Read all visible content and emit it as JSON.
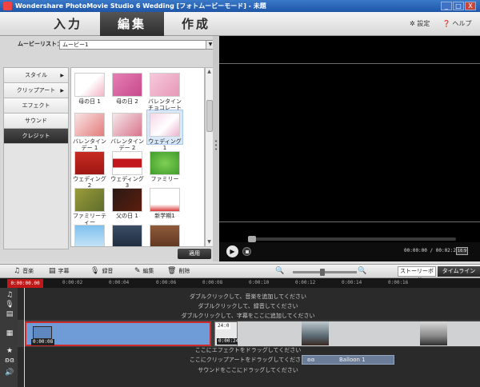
{
  "titlebar": {
    "title": "Wondershare PhotoMovie Studio 6 Wedding [フォトムービーモード] - 未題",
    "min": "_",
    "max": "□",
    "close": "X"
  },
  "top_tabs": [
    {
      "label": "入力"
    },
    {
      "label": "編集"
    },
    {
      "label": "作成"
    }
  ],
  "header": {
    "settings": "設定",
    "help": "ヘルプ"
  },
  "movie_list": {
    "label": "ムービーリスト：",
    "value": "ムービー1"
  },
  "categories": [
    {
      "label": "スタイル"
    },
    {
      "label": "クリップアート"
    },
    {
      "label": "エフェクト"
    },
    {
      "label": "サウンド"
    },
    {
      "label": "クレジット"
    }
  ],
  "thumbnails": [
    {
      "label": "母の日 1"
    },
    {
      "label": "母の日 2"
    },
    {
      "label": "バレンタインチョコレート"
    },
    {
      "label": "バレンタインデー 1"
    },
    {
      "label": "バレンタインデー 2"
    },
    {
      "label": "ウェディング 1"
    },
    {
      "label": "ウェディング 2"
    },
    {
      "label": "ウェディング 3"
    },
    {
      "label": "ファミリー"
    },
    {
      "label": "ファミリーティー"
    },
    {
      "label": "父の日 1"
    },
    {
      "label": "新学期1"
    },
    {
      "label": ""
    },
    {
      "label": ""
    },
    {
      "label": ""
    }
  ],
  "apply_label": "適用",
  "player": {
    "timecode": "00:00:00 / 00:02:20",
    "ratio": "16:9"
  },
  "timeline_toolbar": {
    "music": "音楽",
    "subtitle": "字幕",
    "record": "録音",
    "edit": "編集",
    "delete": "削除",
    "storyboard": "ストーリーボード",
    "timeline": "タイムライン"
  },
  "ruler": {
    "current": "0:00:00.00",
    "ticks": [
      "0:00:02",
      "0:00:04",
      "0:00:06",
      "0:00:08",
      "0:00:10",
      "0:00:12",
      "0:00:14",
      "0:00:16"
    ]
  },
  "hints": {
    "music": "ダブルクリックして、音楽を追加してください",
    "record": "ダブルクリックして、録音してください",
    "subtitle": "ダブルクリックして、字幕をここに追加してください",
    "effect": "ここにエフェクトをドラッグしてください",
    "clipart": "ここにクリップアートをドラッグしてください",
    "sound": "サウンドをここにドラッグしてください"
  },
  "clips": {
    "first_time": "0:00:08",
    "second_time": "0:00:24",
    "second_tag": "24:0"
  },
  "balloon_label": "Balloon 1",
  "colors": {
    "accent_red": "#c31818",
    "selected_clip": "#6f9bd6",
    "tab_active": "#2d2d2d"
  }
}
